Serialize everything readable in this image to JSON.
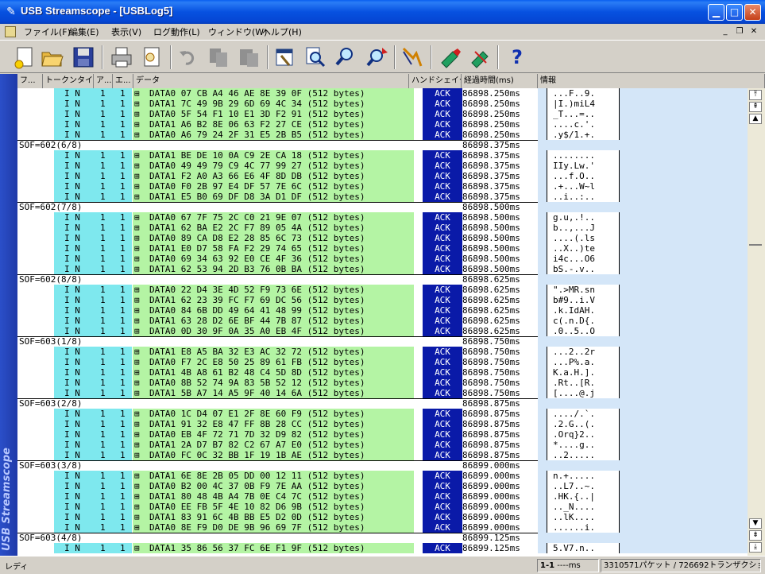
{
  "window": {
    "title": "USB Streamscope - [USBLog5]",
    "sidebar_text": "USB Streamscope"
  },
  "menu": {
    "items": [
      "ファイル(F)",
      "編集(E)",
      "表示(V)",
      "ログ動作(L)",
      "ウィンドウ(W)",
      "ヘルプ(H)"
    ]
  },
  "toolbar": {
    "icons": [
      "new-file-icon",
      "open-folder-icon",
      "save-icon",
      "print-icon",
      "print-preview-icon",
      "undo-icon",
      "copy-icon",
      "paste-icon",
      "hex-tools-icon",
      "find-icon",
      "search-icon",
      "search-next-icon",
      "filter-icon",
      "marker-icon",
      "trigger-icon",
      "help-icon"
    ],
    "help_label": "?"
  },
  "columns": [
    "フ...",
    "トークンタイプ",
    "ア...",
    "エ...",
    "データ",
    "ハンドシェイク",
    "経過時間(ms)",
    "情報"
  ],
  "rows": [
    {
      "t": "d",
      "tok": "I N",
      "a": "1",
      "e": "1",
      "data": "DATA0 07 CB A4 46 AE 8E 39 0F (512 bytes)",
      "hs": "ACK",
      "time": "86898.250ms",
      "info": "...F..9."
    },
    {
      "t": "d",
      "tok": "I N",
      "a": "1",
      "e": "1",
      "data": "DATA1 7C 49 9B 29 6D 69 4C 34 (512 bytes)",
      "hs": "ACK",
      "time": "86898.250ms",
      "info": "|I.)miL4"
    },
    {
      "t": "d",
      "tok": "I N",
      "a": "1",
      "e": "1",
      "data": "DATA0 5F 54 F1 10 E1 3D F2 91 (512 bytes)",
      "hs": "ACK",
      "time": "86898.250ms",
      "info": "_T...=.."
    },
    {
      "t": "d",
      "tok": "I N",
      "a": "1",
      "e": "1",
      "data": "DATA1 A6 B2 8E 06 63 F2 27 CE (512 bytes)",
      "hs": "ACK",
      "time": "86898.250ms",
      "info": "....c.'."
    },
    {
      "t": "d",
      "tok": "I N",
      "a": "1",
      "e": "1",
      "data": "DATA0 A6 79 24 2F 31 E5 2B B5 (512 bytes)",
      "hs": "ACK",
      "time": "86898.250ms",
      "info": ".y$/1.+."
    },
    {
      "t": "s",
      "label": "SOF=602(6/8)",
      "time": "86898.375ms"
    },
    {
      "t": "d",
      "tok": "I N",
      "a": "1",
      "e": "1",
      "data": "DATA1 BE DE 10 0A C9 2E CA 18 (512 bytes)",
      "hs": "ACK",
      "time": "86898.375ms",
      "info": "........"
    },
    {
      "t": "d",
      "tok": "I N",
      "a": "1",
      "e": "1",
      "data": "DATA0 49 49 79 C9 4C 77 99 27 (512 bytes)",
      "hs": "ACK",
      "time": "86898.375ms",
      "info": "IIy.Lw.'"
    },
    {
      "t": "d",
      "tok": "I N",
      "a": "1",
      "e": "1",
      "data": "DATA1 F2 A0 A3 66 E6 4F 8D DB (512 bytes)",
      "hs": "ACK",
      "time": "86898.375ms",
      "info": "...f.O.."
    },
    {
      "t": "d",
      "tok": "I N",
      "a": "1",
      "e": "1",
      "data": "DATA0 F0 2B 97 E4 DF 57 7E 6C (512 bytes)",
      "hs": "ACK",
      "time": "86898.375ms",
      "info": ".+...W~l"
    },
    {
      "t": "d",
      "tok": "I N",
      "a": "1",
      "e": "1",
      "data": "DATA1 E5 B0 69 DF D8 3A D1 DF (512 bytes)",
      "hs": "ACK",
      "time": "86898.375ms",
      "info": "..i..:.."
    },
    {
      "t": "s",
      "label": "SOF=602(7/8)",
      "time": "86898.500ms"
    },
    {
      "t": "d",
      "tok": "I N",
      "a": "1",
      "e": "1",
      "data": "DATA0 67 7F 75 2C C0 21 9E 07 (512 bytes)",
      "hs": "ACK",
      "time": "86898.500ms",
      "info": "g.u,.!.."
    },
    {
      "t": "d",
      "tok": "I N",
      "a": "1",
      "e": "1",
      "data": "DATA1 62 BA E2 2C F7 89 05 4A (512 bytes)",
      "hs": "ACK",
      "time": "86898.500ms",
      "info": "b..,...J"
    },
    {
      "t": "d",
      "tok": "I N",
      "a": "1",
      "e": "1",
      "data": "DATA0 89 CA D8 E2 28 85 6C 73 (512 bytes)",
      "hs": "ACK",
      "time": "86898.500ms",
      "info": "....(.ls"
    },
    {
      "t": "d",
      "tok": "I N",
      "a": "1",
      "e": "1",
      "data": "DATA1 E0 D7 58 FA F2 29 74 65 (512 bytes)",
      "hs": "ACK",
      "time": "86898.500ms",
      "info": "..X..)te"
    },
    {
      "t": "d",
      "tok": "I N",
      "a": "1",
      "e": "1",
      "data": "DATA0 69 34 63 92 E0 CE 4F 36 (512 bytes)",
      "hs": "ACK",
      "time": "86898.500ms",
      "info": "i4c...O6"
    },
    {
      "t": "d",
      "tok": "I N",
      "a": "1",
      "e": "1",
      "data": "DATA1 62 53 94 2D B3 76 0B BA (512 bytes)",
      "hs": "ACK",
      "time": "86898.500ms",
      "info": "bS.-.v.."
    },
    {
      "t": "s",
      "label": "SOF=602(8/8)",
      "time": "86898.625ms"
    },
    {
      "t": "d",
      "tok": "I N",
      "a": "1",
      "e": "1",
      "data": "DATA0 22 D4 3E 4D 52 F9 73 6E (512 bytes)",
      "hs": "ACK",
      "time": "86898.625ms",
      "info": "\".>MR.sn"
    },
    {
      "t": "d",
      "tok": "I N",
      "a": "1",
      "e": "1",
      "data": "DATA1 62 23 39 FC F7 69 DC 56 (512 bytes)",
      "hs": "ACK",
      "time": "86898.625ms",
      "info": "b#9..i.V"
    },
    {
      "t": "d",
      "tok": "I N",
      "a": "1",
      "e": "1",
      "data": "DATA0 84 6B DD 49 64 41 48 99 (512 bytes)",
      "hs": "ACK",
      "time": "86898.625ms",
      "info": ".k.IdAH."
    },
    {
      "t": "d",
      "tok": "I N",
      "a": "1",
      "e": "1",
      "data": "DATA1 63 28 D2 6E BF 44 7B 87 (512 bytes)",
      "hs": "ACK",
      "time": "86898.625ms",
      "info": "c(.n.D{."
    },
    {
      "t": "d",
      "tok": "I N",
      "a": "1",
      "e": "1",
      "data": "DATA0 0D 30 9F 0A 35 A0 EB 4F (512 bytes)",
      "hs": "ACK",
      "time": "86898.625ms",
      "info": ".0..5..O"
    },
    {
      "t": "s",
      "label": "SOF=603(1/8)",
      "time": "86898.750ms"
    },
    {
      "t": "d",
      "tok": "I N",
      "a": "1",
      "e": "1",
      "data": "DATA1 E8 A5 BA 32 E3 AC 32 72 (512 bytes)",
      "hs": "ACK",
      "time": "86898.750ms",
      "info": "...2..2r"
    },
    {
      "t": "d",
      "tok": "I N",
      "a": "1",
      "e": "1",
      "data": "DATA0 F7 2C E8 50 25 89 61 FB (512 bytes)",
      "hs": "ACK",
      "time": "86898.750ms",
      "info": "...P%.a."
    },
    {
      "t": "d",
      "tok": "I N",
      "a": "1",
      "e": "1",
      "data": "DATA1 4B A8 61 B2 48 C4 5D 8D (512 bytes)",
      "hs": "ACK",
      "time": "86898.750ms",
      "info": "K.a.H.]."
    },
    {
      "t": "d",
      "tok": "I N",
      "a": "1",
      "e": "1",
      "data": "DATA0 8B 52 74 9A 83 5B 52 12 (512 bytes)",
      "hs": "ACK",
      "time": "86898.750ms",
      "info": ".Rt..[R."
    },
    {
      "t": "d",
      "tok": "I N",
      "a": "1",
      "e": "1",
      "data": "DATA1 5B A7 14 A5 9F 40 14 6A (512 bytes)",
      "hs": "ACK",
      "time": "86898.750ms",
      "info": "[....@.j"
    },
    {
      "t": "s",
      "label": "SOF=603(2/8)",
      "time": "86898.875ms"
    },
    {
      "t": "d",
      "tok": "I N",
      "a": "1",
      "e": "1",
      "data": "DATA0 1C D4 07 E1 2F 8E 60 F9 (512 bytes)",
      "hs": "ACK",
      "time": "86898.875ms",
      "info": "..../.`."
    },
    {
      "t": "d",
      "tok": "I N",
      "a": "1",
      "e": "1",
      "data": "DATA1 91 32 E8 47 FF 8B 28 CC (512 bytes)",
      "hs": "ACK",
      "time": "86898.875ms",
      "info": ".2.G..(."
    },
    {
      "t": "d",
      "tok": "I N",
      "a": "1",
      "e": "1",
      "data": "DATA0 EB 4F 72 71 7D 32 D9 82 (512 bytes)",
      "hs": "ACK",
      "time": "86898.875ms",
      "info": ".Orq}2.."
    },
    {
      "t": "d",
      "tok": "I N",
      "a": "1",
      "e": "1",
      "data": "DATA1 2A D7 B7 82 C2 67 A7 E0 (512 bytes)",
      "hs": "ACK",
      "time": "86898.875ms",
      "info": "*....g.."
    },
    {
      "t": "d",
      "tok": "I N",
      "a": "1",
      "e": "1",
      "data": "DATA0 FC 0C 32 BB 1F 19 1B AE (512 bytes)",
      "hs": "ACK",
      "time": "86898.875ms",
      "info": "..2....."
    },
    {
      "t": "s",
      "label": "SOF=603(3/8)",
      "time": "86899.000ms"
    },
    {
      "t": "d",
      "tok": "I N",
      "a": "1",
      "e": "1",
      "data": "DATA1 6E 8E 2B 05 DD 00 12 11 (512 bytes)",
      "hs": "ACK",
      "time": "86899.000ms",
      "info": "n.+....."
    },
    {
      "t": "d",
      "tok": "I N",
      "a": "1",
      "e": "1",
      "data": "DATA0 B2 00 4C 37 0B F9 7E AA (512 bytes)",
      "hs": "ACK",
      "time": "86899.000ms",
      "info": "..L7..~."
    },
    {
      "t": "d",
      "tok": "I N",
      "a": "1",
      "e": "1",
      "data": "DATA1 80 48 4B A4 7B 0E C4 7C (512 bytes)",
      "hs": "ACK",
      "time": "86899.000ms",
      "info": ".HK.{..|"
    },
    {
      "t": "d",
      "tok": "I N",
      "a": "1",
      "e": "1",
      "data": "DATA0 EE FB 5F 4E 10 82 D6 9B (512 bytes)",
      "hs": "ACK",
      "time": "86899.000ms",
      "info": ".._N...."
    },
    {
      "t": "d",
      "tok": "I N",
      "a": "1",
      "e": "1",
      "data": "DATA1 83 91 6C 4B BB E5 D2 0D (512 bytes)",
      "hs": "ACK",
      "time": "86899.000ms",
      "info": "..lK...."
    },
    {
      "t": "d",
      "tok": "I N",
      "a": "1",
      "e": "1",
      "data": "DATA0 8E F9 D0 DE 9B 96 69 7F (512 bytes)",
      "hs": "ACK",
      "time": "86899.000ms",
      "info": "......i."
    },
    {
      "t": "s",
      "label": "SOF=603(4/8)",
      "time": "86899.125ms"
    },
    {
      "t": "d",
      "tok": "I N",
      "a": "1",
      "e": "1",
      "data": "DATA1 35 86 56 37 FC 6E F1 9F (512 bytes)",
      "hs": "ACK",
      "time": "86899.125ms",
      "info": "5.V7.n.."
    }
  ],
  "statusbar": {
    "ready": "レディ",
    "position": "1-1",
    "time_unit": "----ms",
    "counts": "3310571パケット / 726692トランザクション"
  }
}
